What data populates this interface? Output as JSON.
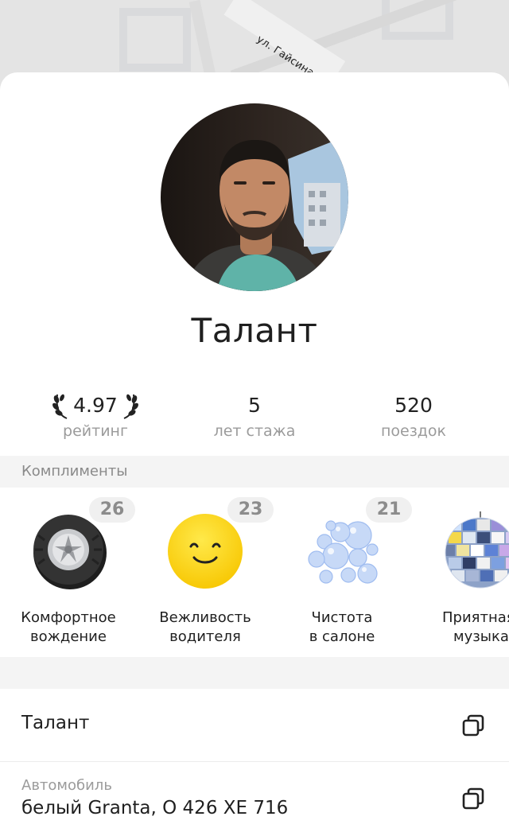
{
  "map": {
    "street_label": "ул. Гайсина"
  },
  "driver": {
    "name": "Талант",
    "avatar_alt": "driver-photo"
  },
  "stats": [
    {
      "value": "4.97",
      "label": "рейтинг"
    },
    {
      "value": "5",
      "label": "лет стажа"
    },
    {
      "value": "520",
      "label": "поездок"
    }
  ],
  "compliments": {
    "header": "Комплименты",
    "items": [
      {
        "count": "26",
        "line1": "Комфортное",
        "line2": "вождение",
        "icon": "wheel-icon"
      },
      {
        "count": "23",
        "line1": "Вежливость",
        "line2": "водителя",
        "icon": "smiley-icon"
      },
      {
        "count": "21",
        "line1": "Чистота",
        "line2": "в салоне",
        "icon": "bubbles-icon"
      },
      {
        "count": "",
        "line1": "Приятная",
        "line2": "музыка",
        "icon": "disco-ball-icon"
      }
    ]
  },
  "details": {
    "driver_row": {
      "value": "Талант"
    },
    "car_row": {
      "label": "Автомобиль",
      "value": "белый Granta, О 426 ХЕ 716"
    }
  },
  "colors": {
    "smiley": "#ffd60a",
    "section_bg": "#f4f4f4",
    "muted_text": "#9b9b9b"
  }
}
